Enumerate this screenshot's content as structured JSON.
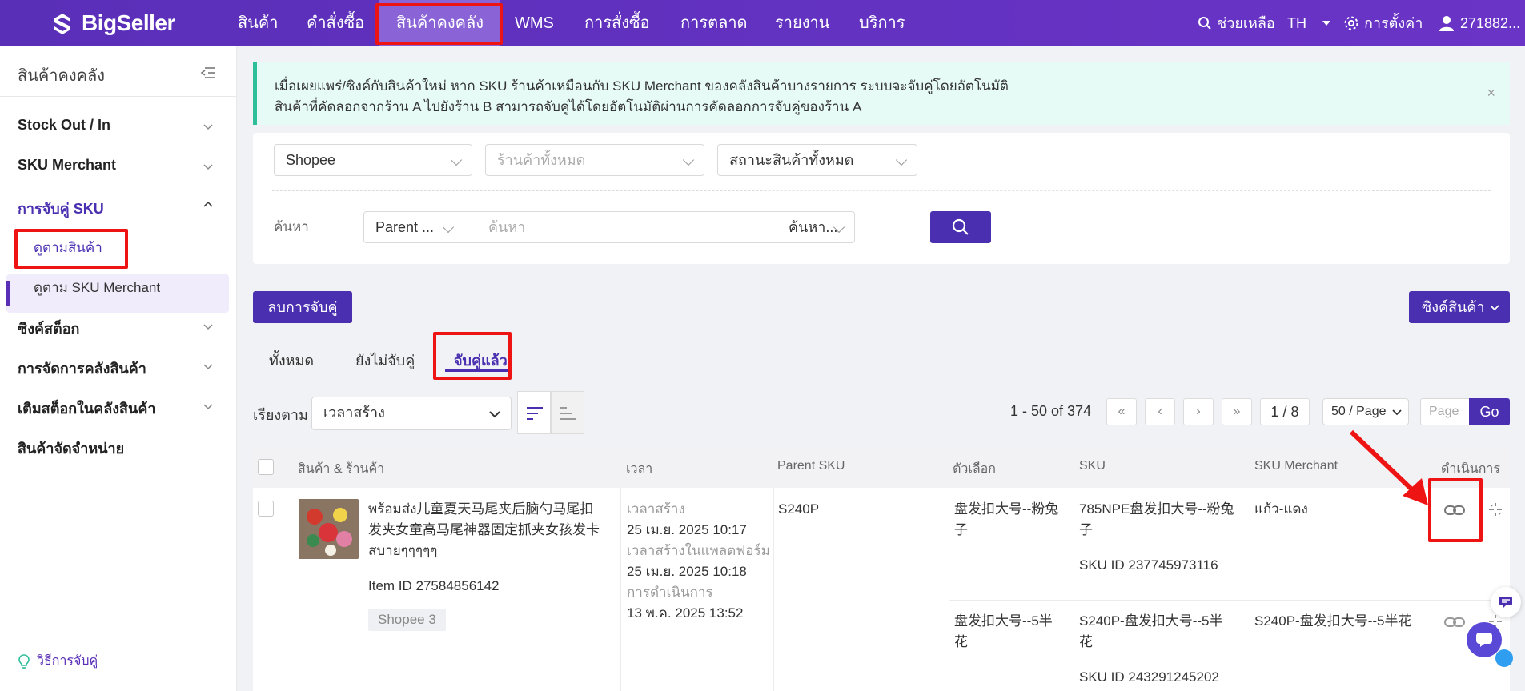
{
  "brand": {
    "name": "BigSeller"
  },
  "topnav": {
    "items": [
      "สินค้า",
      "คำสั่งซื้อ",
      "สินค้าคงคลัง",
      "WMS",
      "การสั่งซื้อ",
      "การตลาด",
      "รายงาน",
      "บริการ"
    ],
    "active": "สินค้าคงคลัง",
    "help": "ช่วยเหลือ",
    "lang": "TH",
    "settings": "การตั้งค่า",
    "user": "271882..."
  },
  "sidebar": {
    "title": "สินค้าคงคลัง",
    "items": [
      {
        "label": "Stock Out / In"
      },
      {
        "label": "SKU Merchant"
      },
      {
        "label": "การจับคู่ SKU",
        "active": true
      },
      {
        "label": "ซิงค์สต็อก"
      },
      {
        "label": "การจัดการคลังสินค้า"
      },
      {
        "label": "เติมสต็อกในคลังสินค้า"
      },
      {
        "label": "สินค้าจัดจำหน่าย"
      }
    ],
    "subitems": [
      {
        "label": "ดูตามสินค้า",
        "active": true
      },
      {
        "label": "ดูตาม SKU Merchant"
      }
    ],
    "footer": "วิธีการจับคู่"
  },
  "banner": {
    "line1": "เมื่อเผยแพร่/ซิงค์กับสินค้าใหม่ หาก SKU ร้านค้าเหมือนกับ SKU Merchant ของคลังสินค้าบางรายการ ระบบจะจับคู่โดยอัตโนมัติ",
    "line2": "สินค้าที่คัดลอกจากร้าน A ไปยังร้าน B สามารถจับคู่ได้โดยอัตโนมัติผ่านการคัดลอกการจับคู่ของร้าน A",
    "close": "×"
  },
  "filters": {
    "platform": "Shopee",
    "store_placeholder": "ร้านค้าทั้งหมด",
    "status_placeholder": "สถานะสินค้าทั้งหมด",
    "search_label": "ค้นหา",
    "search_type": "Parent ...",
    "search_placeholder": "ค้นหา",
    "search_mode": "ค้นหา..."
  },
  "actions": {
    "unmatch": "ลบการจับคู่",
    "sync": "ซิงค์สินค้า"
  },
  "tabs": [
    "ทั้งหมด",
    "ยังไม่จับคู่",
    "จับคู่แล้ว"
  ],
  "active_tab": "จับคู่แล้ว",
  "sort": {
    "label": "เรียงตาม",
    "value": "เวลาสร้าง"
  },
  "pager": {
    "range": "1 - 50 of 374",
    "page": "1 / 8",
    "per_page": "50 / Page",
    "page_placeholder": "Page",
    "go": "Go"
  },
  "table": {
    "headers": [
      "สินค้า & ร้านค้า",
      "เวลา",
      "Parent SKU",
      "ตัวเลือก",
      "SKU",
      "SKU Merchant",
      "ดำเนินการ"
    ],
    "row": {
      "title_line1": "พร้อมส่ง儿童夏天马尾夹后脑勺马尾扣",
      "title_line2": "发夹女童高马尾神器固定抓夹女孩发卡",
      "title_line3": "สบายๆๆๆๆๆ",
      "item_id": "Item ID 27584856142",
      "shop": "Shopee 3",
      "time_created_label": "เวลาสร้าง",
      "time_created": "25 เม.ย. 2025 10:17",
      "time_platform_label": "เวลาสร้างในแพลตฟอร์ม",
      "time_platform": "25 เม.ย. 2025 10:18",
      "time_action_label": "การดำเนินการ",
      "time_action": "13 พ.ค. 2025 13:52",
      "parent_sku": "S240P",
      "variants": [
        {
          "option_l1": "盘发扣大号--粉兔",
          "option_l2": "子",
          "sku_l1": "785NPE盘发扣大号--粉兔",
          "sku_l2": "子",
          "sku_id": "SKU ID 237745973116",
          "merchant": "แก้ว-แดง"
        },
        {
          "option_l1": "盘发扣大号--5半",
          "option_l2": "花",
          "sku_l1": "S240P-盘发扣大号--5半",
          "sku_l2": "花",
          "sku_id": "SKU ID 243291245202",
          "merchant": "S240P-盘发扣大号--5半花"
        }
      ]
    }
  },
  "colors": {
    "brand": "#5a2fb8",
    "button": "#4a2fb0",
    "highlight": "#ef1414",
    "banner_bg": "#e6fbf6",
    "banner_accent": "#2dbf9a"
  }
}
